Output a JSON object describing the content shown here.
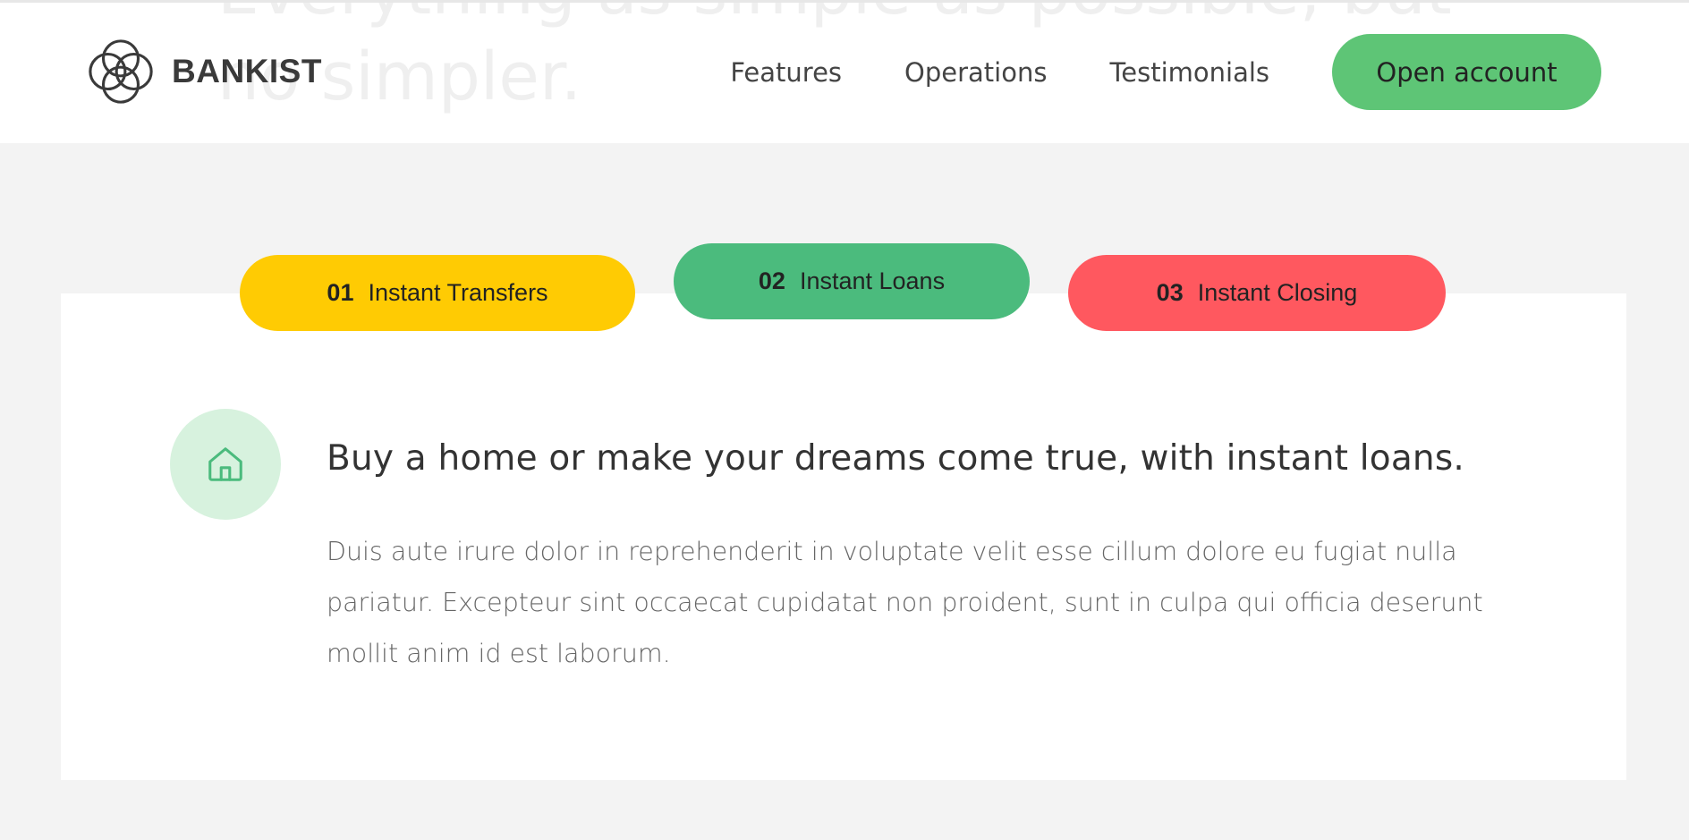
{
  "background_heading": {
    "line1": "Everything as simple as possible, but",
    "line2": "no simpler."
  },
  "nav": {
    "logo_text": "BANKIST",
    "links": [
      {
        "label": "Features"
      },
      {
        "label": "Operations"
      },
      {
        "label": "Testimonials"
      }
    ],
    "cta_label": "Open account"
  },
  "operations": {
    "tabs": [
      {
        "number": "01",
        "label": "Instant Transfers",
        "color": "#ffcb03",
        "active": false
      },
      {
        "number": "02",
        "label": "Instant Loans",
        "color": "#4bbb7d",
        "active": true
      },
      {
        "number": "03",
        "label": "Instant Closing",
        "color": "#ff585f",
        "active": false
      }
    ],
    "content": {
      "icon": "home-icon",
      "title": "Buy a home or make your dreams come true, with instant loans.",
      "text": "Duis aute irure dolor in reprehenderit in voluptate velit esse cillum dolore eu fugiat nulla pariatur. Excepteur sint occaecat cupidatat non proident, sunt in culpa qui officia deserunt mollit anim id est laborum."
    }
  },
  "colors": {
    "accent_green": "#5ec576",
    "page_background": "#f3f3f3",
    "icon_circle_bg": "#d7f2de"
  }
}
